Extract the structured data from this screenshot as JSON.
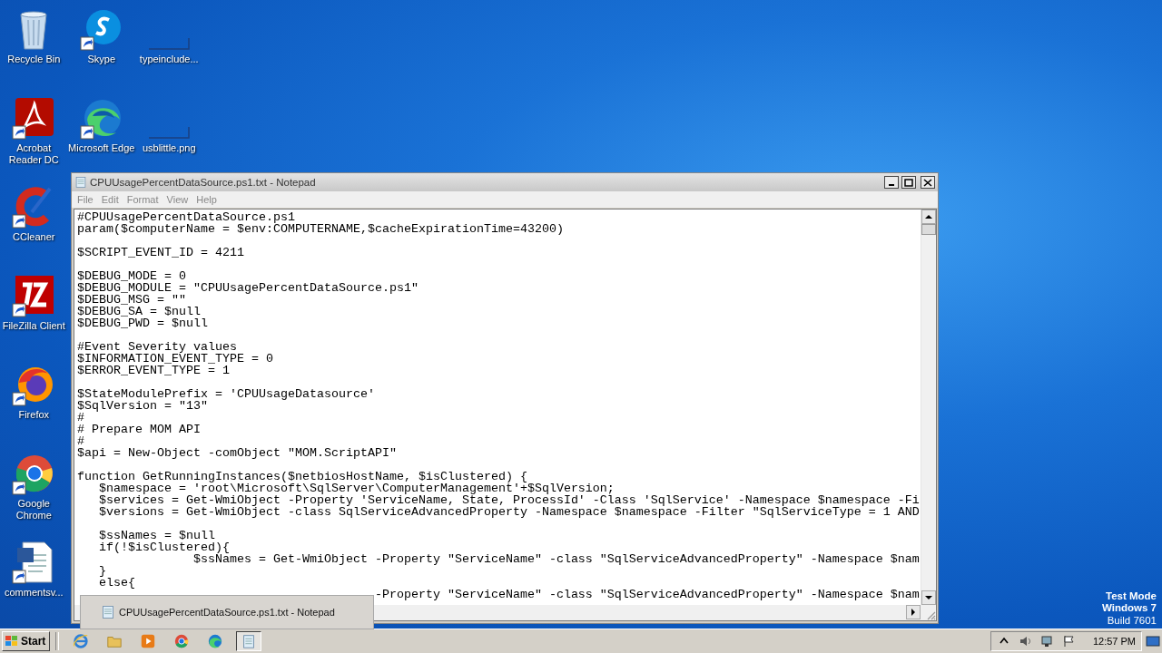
{
  "desktop_columns": [
    [
      {
        "label": "Recycle Bin",
        "kind": "recycle-bin"
      },
      {
        "label": "Acrobat Reader DC",
        "kind": "pdf"
      },
      {
        "label": "CCleaner",
        "kind": "cleaner"
      },
      {
        "label": "FileZilla Client",
        "kind": "ftp"
      },
      {
        "label": "Firefox",
        "kind": "firefox"
      },
      {
        "label": "Google Chrome",
        "kind": "chrome"
      },
      {
        "label": "commentsv...",
        "kind": "document"
      }
    ],
    [
      {
        "label": "Skype",
        "kind": "chat"
      },
      {
        "label": "Microsoft Edge",
        "kind": "edge"
      }
    ],
    [
      {
        "label": "typeinclude...",
        "kind": "blank"
      },
      {
        "label": "usblittle.png",
        "kind": "blank"
      }
    ]
  ],
  "notepad": {
    "title": "CPUUsagePercentDataSource.ps1.txt - Notepad",
    "menu": [
      "File",
      "Edit",
      "Format",
      "View",
      "Help"
    ],
    "blocks": [
      [
        "#CPUUsagePercentDataSource.ps1",
        "param($computerName = $env:COMPUTERNAME,$cacheExpirationTime=43200)"
      ],
      [
        "$SCRIPT_EVENT_ID = 4211"
      ],
      [
        "$DEBUG_MODE = 0",
        "$DEBUG_MODULE = \"CPUUsagePercentDataSource.ps1\"",
        "$DEBUG_MSG = \"\"",
        "$DEBUG_SA = $null",
        "$DEBUG_PWD = $null"
      ],
      [
        "#Event Severity values",
        "$INFORMATION_EVENT_TYPE = 0",
        "$ERROR_EVENT_TYPE = 1"
      ],
      [
        "$StateModulePrefix = 'CPUUsageDatasource'",
        "$SqlVersion = \"13\"",
        "#",
        "# Prepare MOM API",
        "#",
        "$api = New-Object -comObject \"MOM.ScriptAPI\""
      ],
      [
        "function GetRunningInstances($netbiosHostName, $isClustered) {",
        "   $namespace = 'root\\Microsoft\\SqlServer\\ComputerManagement'+$SqlVersion;",
        "   $services = Get-WmiObject -Property 'ServiceName, State, ProcessId' -Class 'SqlService' -Namespace $namespace -Fi",
        "   $versions = Get-WmiObject -class SqlServiceAdvancedProperty -Namespace $namespace -Filter \"SqlServiceType = 1 AND"
      ],
      [
        "   $ssNames = $null",
        "   if(!$isClustered){",
        "                $ssNames = Get-WmiObject -Property \"ServiceName\" -class \"SqlServiceAdvancedProperty\" -Namespace $nam",
        "   }",
        "   else{",
        "                                         -Property \"ServiceName\" -class \"SqlServiceAdvancedProperty\" -Namespace $nam"
      ]
    ]
  },
  "taskbar_preview": {
    "title": "CPUUsagePercentDataSource.ps1.txt - Notepad"
  },
  "system_info": [
    "Test Mode",
    "Windows 7",
    "Build 7601"
  ],
  "taskbar": {
    "start": "Start",
    "apps": [
      {
        "kind": "ie",
        "selected": false
      },
      {
        "kind": "folder",
        "selected": false
      },
      {
        "kind": "media",
        "selected": false
      },
      {
        "kind": "chrome",
        "selected": false
      },
      {
        "kind": "edge",
        "selected": false
      },
      {
        "kind": "notepad",
        "selected": true
      }
    ],
    "clock": "12:57 PM"
  }
}
